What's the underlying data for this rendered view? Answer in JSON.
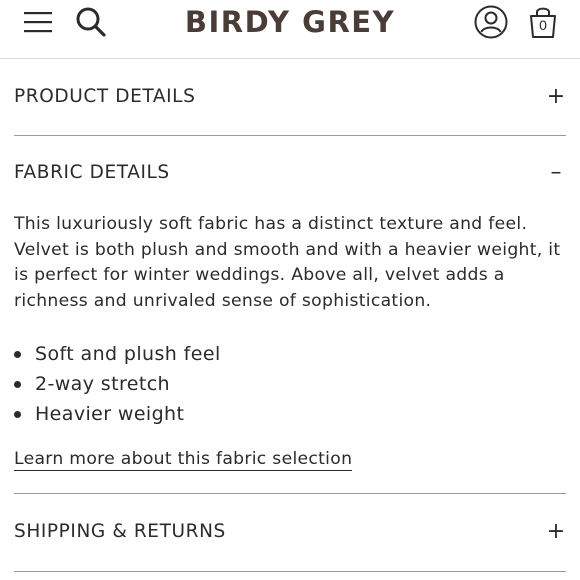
{
  "header": {
    "brand": "BIRDY GREY",
    "cart_count": "0",
    "brand_color": "#4a3c36",
    "icons": [
      "hamburger-menu-icon",
      "search-icon",
      "account-icon",
      "shopping-bag-icon"
    ]
  },
  "accordion": {
    "product_details": {
      "title": "PRODUCT DETAILS",
      "toggle": "+",
      "expanded": false
    },
    "fabric_details": {
      "title": "FABRIC DETAILS",
      "toggle": "–",
      "expanded": true,
      "description": "This luxuriously soft fabric has a distinct texture and feel. Velvet is both plush and smooth and with a heavier weight, it is perfect for winter weddings. Above all, velvet adds a richness and unrivaled sense of sophistication.",
      "features": [
        "Soft and plush feel",
        "2-way stretch",
        "Heavier weight"
      ],
      "link": "Learn more about this fabric selection"
    },
    "shipping_returns": {
      "title": "SHIPPING & RETURNS",
      "toggle": "+",
      "expanded": false
    }
  }
}
